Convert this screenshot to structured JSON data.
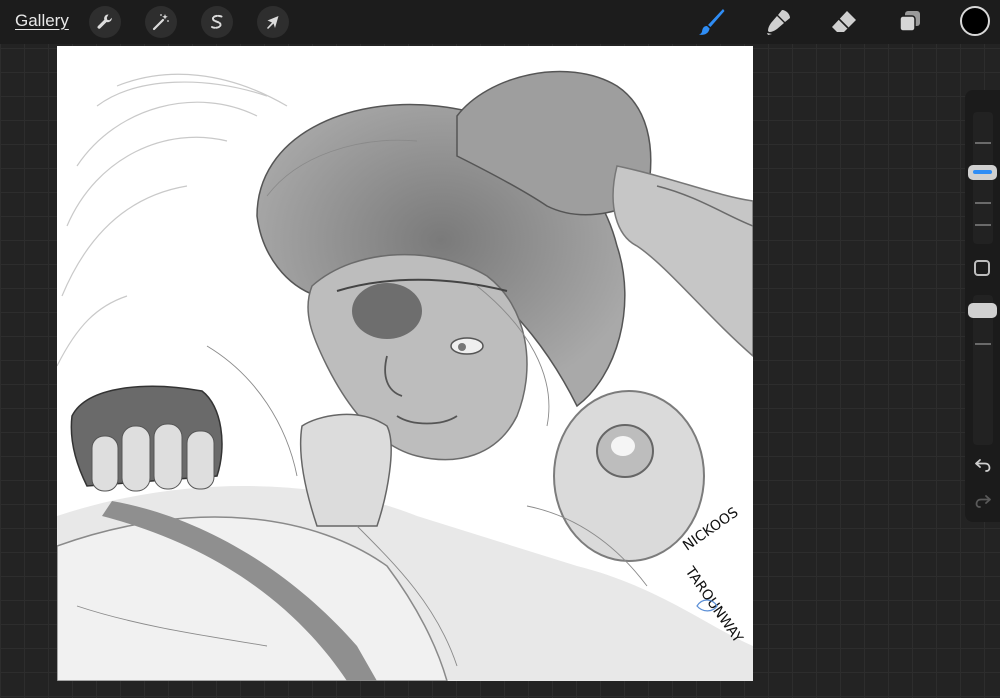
{
  "topbar": {
    "gallery_label": "Gallery",
    "left_tools": [
      {
        "name": "actions",
        "icon": "wrench-icon"
      },
      {
        "name": "adjustments",
        "icon": "magic-wand-icon"
      },
      {
        "name": "selection",
        "icon": "selection-s-icon"
      },
      {
        "name": "transform",
        "icon": "arrow-cursor-icon"
      }
    ],
    "right_tools": [
      {
        "name": "brush",
        "icon": "brush-icon",
        "active": true
      },
      {
        "name": "smudge",
        "icon": "smudge-icon",
        "active": false
      },
      {
        "name": "eraser",
        "icon": "eraser-icon",
        "active": false
      },
      {
        "name": "layers",
        "icon": "layers-icon",
        "active": false
      }
    ],
    "current_color": "#000000"
  },
  "canvas": {
    "signature_line1": "NICKOOS",
    "signature_line2": "TAROUNWAY"
  },
  "sidebar": {
    "brush_size_level": 0.42,
    "opacity_level": 1.0,
    "undo_icon": "undo-icon",
    "redo_icon": "redo-icon"
  },
  "colors": {
    "accent": "#2f8df5",
    "chrome": "#1c1c1c",
    "background": "#232323",
    "canvas": "#ffffff"
  }
}
